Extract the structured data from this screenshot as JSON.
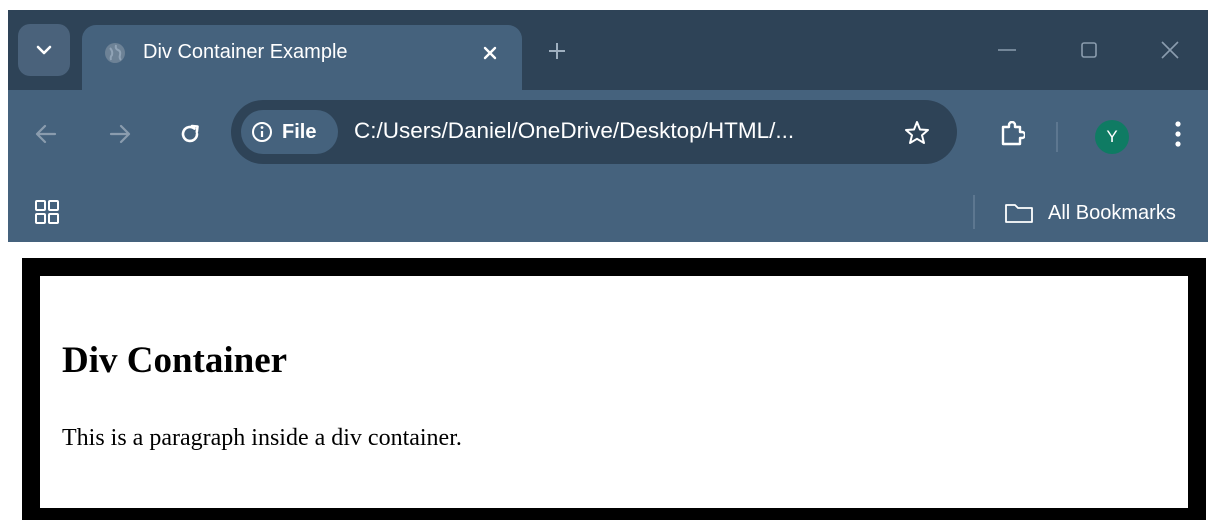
{
  "browser": {
    "tab": {
      "title": "Div Container Example"
    },
    "address_bar": {
      "security_chip_label": "File",
      "url": "C:/Users/Daniel/OneDrive/Desktop/HTML/..."
    },
    "profile": {
      "initial": "Y",
      "color": "#0f7b63"
    },
    "bookmarks_bar": {
      "all_bookmarks_label": "All Bookmarks"
    },
    "icons": {
      "tab_search": "chevron-down-icon",
      "favicon": "globe-icon",
      "tab_close": "close-icon",
      "new_tab": "plus-icon",
      "minimize": "minimize-icon",
      "maximize": "maximize-icon",
      "window_close": "close-icon",
      "back": "arrow-left-icon",
      "forward": "arrow-right-icon",
      "reload": "reload-icon",
      "site_info": "info-icon",
      "bookmark": "star-icon",
      "extensions": "puzzle-icon",
      "menu": "kebab-menu-icon",
      "apps": "apps-grid-icon",
      "bookmarks_folder": "folder-icon"
    },
    "colors": {
      "frame": "#2e4357",
      "toolbar": "#45627d",
      "text": "#ffffff"
    }
  },
  "page": {
    "heading": "Div Container",
    "paragraph": "This is a paragraph inside a div container.",
    "container_border_color": "#000000"
  }
}
